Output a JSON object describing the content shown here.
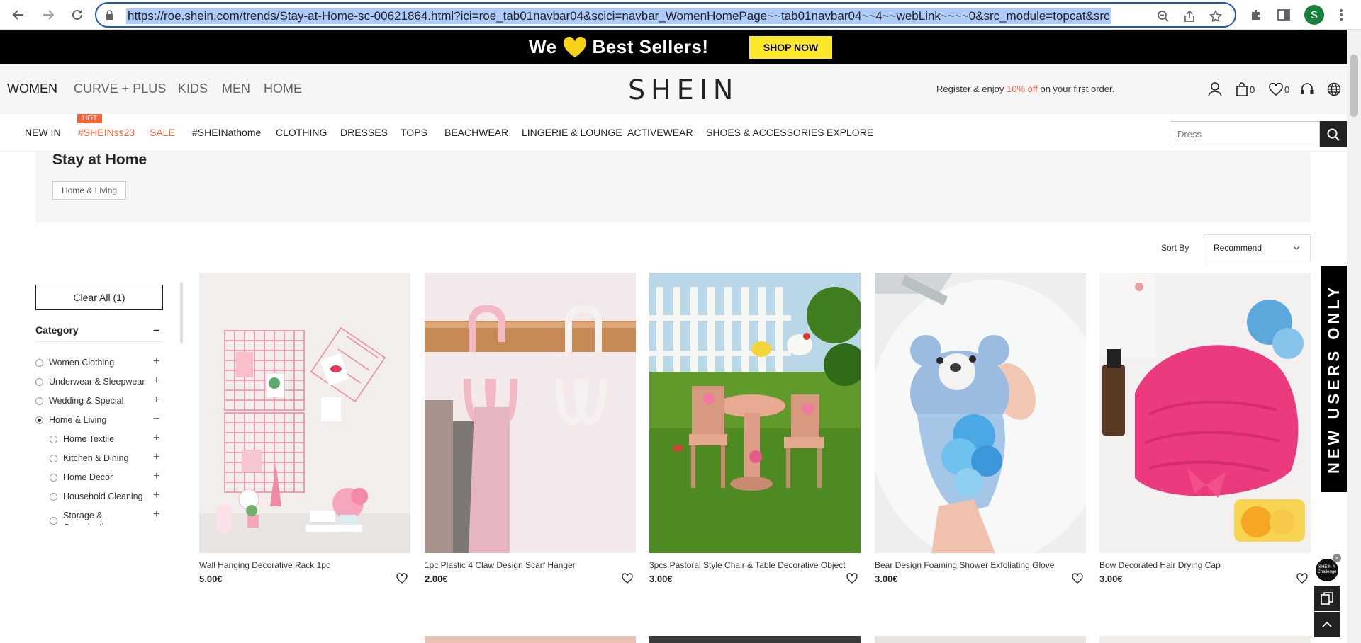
{
  "browser": {
    "url": "https://roe.shein.com/trends/Stay-at-Home-sc-00621864.html?ici=roe_tab01navbar04&scici=navbar_WomenHomePage~~tab01navbar04~~4~~webLink~~~~0&src_module=topcat&src",
    "profile_initial": "S",
    "icons": [
      "back-icon",
      "forward-icon",
      "reload-icon",
      "lock-icon",
      "zoom-icon",
      "share-icon",
      "star-icon",
      "extensions-icon",
      "sidepanel-icon",
      "menu-icon"
    ]
  },
  "promo": {
    "text_before": "We",
    "text_after": "Best Sellers!",
    "button": "SHOP NOW",
    "heart_color": "#f7d117"
  },
  "header": {
    "top_categories": [
      "WOMEN",
      "CURVE + PLUS",
      "KIDS",
      "MEN",
      "HOME"
    ],
    "active_category": "WOMEN",
    "logo": "SHEIN",
    "register_before": "Register & enjoy ",
    "register_highlight": "10% off",
    "register_after": " on your first order.",
    "bag_count": "0",
    "wishlist_count": "0"
  },
  "nav": {
    "hot_badge": "HOT",
    "items": [
      "NEW IN",
      "#SHEINss23",
      "SALE",
      "#SHEINathome",
      "CLOTHING",
      "DRESSES",
      "TOPS",
      "BEACHWEAR",
      "LINGERIE & LOUNGE",
      "ACTIVEWEAR",
      "SHOES & ACCESSORIES",
      "EXPLORE"
    ],
    "search_placeholder": "Dress",
    "accent_color": "#fa6338"
  },
  "page": {
    "title": "Stay at Home",
    "tag": "Home & Living",
    "sort_label": "Sort By",
    "sort_value": "Recommend"
  },
  "filters": {
    "clear_all": "Clear All (1)",
    "category_title": "Category",
    "category_toggle": "−",
    "categories": [
      {
        "label": "Women Clothing",
        "expand": "+"
      },
      {
        "label": "Underwear & Sleepwear",
        "expand": "+"
      },
      {
        "label": "Wedding & Special",
        "expand": "+"
      },
      {
        "label": "Home & Living",
        "expand": "−",
        "selected": true
      }
    ],
    "subcategories": [
      {
        "label": "Home Textile",
        "expand": "+"
      },
      {
        "label": "Kitchen & Dining",
        "expand": "+"
      },
      {
        "label": "Home Decor",
        "expand": "+"
      },
      {
        "label": "Household Cleaning",
        "expand": "+"
      },
      {
        "label": "Storage & Organization",
        "expand": "+"
      }
    ]
  },
  "products": [
    {
      "name": "Wall Hanging Decorative Rack 1pc",
      "price": "5.00€"
    },
    {
      "name": "1pc Plastic 4 Claw Design Scarf Hanger",
      "price": "2.00€"
    },
    {
      "name": "3pcs Pastoral Style Chair & Table Decorative Object",
      "price": "3.00€"
    },
    {
      "name": "Bear Design Foaming Shower Exfoliating Glove",
      "price": "3.00€"
    },
    {
      "name": "Bow Decorated Hair Drying Cap",
      "price": "3.00€"
    }
  ],
  "side": {
    "new_users": "NEW USERS ONLY",
    "challenge": "SHEIN X Challenge",
    "close": "×"
  }
}
